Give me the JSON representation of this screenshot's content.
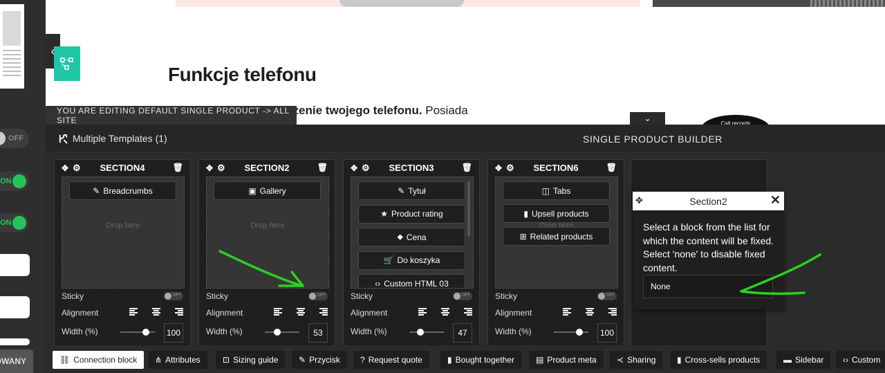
{
  "preview": {
    "heading": "Funkcje telefonu",
    "paragraph_bold": "łać jako przedłużenie twojego telefonu.",
    "paragraph_rest": " Posiada",
    "circle_label": "Call records",
    "editing_banner": "YOU ARE EDITING DEFAULT SINGLE PRODUCT -> ALL SITE"
  },
  "sidebar": {
    "toggle_off_label": "OFF",
    "toggle_on_label": "ON",
    "bottom_button_label": "OWANY"
  },
  "builder": {
    "templates_label": "Multiple Templates (1)",
    "title": "SINGLE PRODUCT BUILDER",
    "sticky_label": "Sticky",
    "alignment_label": "Alignment",
    "width_label": "Width (%)",
    "drop_here": "Drop here",
    "mini_toggle_off": "OFF",
    "sections": [
      {
        "name": "SECTION4",
        "blocks": [
          "Breadcrumbs"
        ],
        "width": "100",
        "slider": 1.0,
        "drop_hint": true
      },
      {
        "name": "SECTION2",
        "blocks": [
          "Gallery"
        ],
        "width": "53",
        "slider": 0.53,
        "drop_hint": true
      },
      {
        "name": "SECTION3",
        "blocks": [
          "Tytuł",
          "Product rating",
          "Cena",
          "Do koszyka",
          "Custom HTML 03"
        ],
        "width": "47",
        "slider": 0.47,
        "drop_hint": false
      },
      {
        "name": "SECTION6",
        "blocks": [
          "Tabs",
          "Upsell products",
          "Related products"
        ],
        "width": "100",
        "slider": 1.0,
        "drop_hint": true
      }
    ]
  },
  "popup": {
    "title": "Section2",
    "description": "Select a block from the list for which the content will be fixed. Select 'none' to disable fixed content.",
    "select_value": "None"
  },
  "tabs": [
    {
      "label": "Connection block",
      "icon": "link-icon",
      "active": true
    },
    {
      "label": "Attributes",
      "icon": "sitemap-icon",
      "active": false
    },
    {
      "label": "Sizing guide",
      "icon": "ruler-icon",
      "active": false
    },
    {
      "label": "Przycisk",
      "icon": "pencil-icon",
      "active": false
    },
    {
      "label": "Request quote",
      "icon": "question-icon",
      "active": false
    },
    {
      "label": "Bought together",
      "icon": "bag-icon",
      "active": false
    },
    {
      "label": "Product meta",
      "icon": "document-icon",
      "active": false
    },
    {
      "label": "Sharing",
      "icon": "share-icon",
      "active": false
    },
    {
      "label": "Cross-sells products",
      "icon": "bag-icon",
      "active": false
    },
    {
      "label": "Sidebar",
      "icon": "folder-icon",
      "active": false
    },
    {
      "label": "Custom",
      "icon": "code-icon",
      "active": false
    }
  ],
  "colors": {
    "accent_green": "#27c35a",
    "teal_icon": "#1fc7a6",
    "annotation_green": "#2ad11f"
  }
}
